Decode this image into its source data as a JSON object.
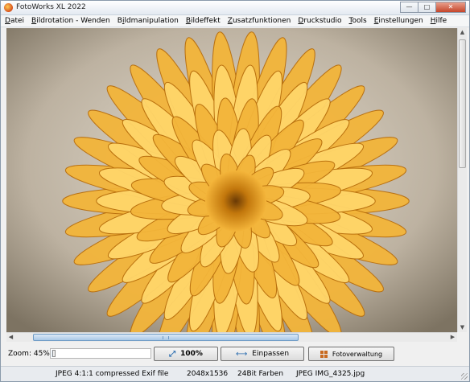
{
  "window": {
    "title": "FotoWorks XL 2022",
    "icon": "fotoworks-app-icon"
  },
  "menu": [
    {
      "pre": "",
      "u": "D",
      "post": "atei"
    },
    {
      "pre": "",
      "u": "B",
      "post": "ildrotation - Wenden"
    },
    {
      "pre": "B",
      "u": "i",
      "post": "ldmanipulation"
    },
    {
      "pre": "",
      "u": "B",
      "post": "ildeffekt"
    },
    {
      "pre": "",
      "u": "Z",
      "post": "usatzfunktionen"
    },
    {
      "pre": "",
      "u": "D",
      "post": "ruckstudio"
    },
    {
      "pre": "",
      "u": "T",
      "post": "ools"
    },
    {
      "pre": "",
      "u": "E",
      "post": "instellungen"
    },
    {
      "pre": "",
      "u": "H",
      "post": "ilfe"
    }
  ],
  "photo": {
    "subject": "yellow dahlia flower",
    "colors": {
      "petal": "#f3b53a",
      "shadow": "#b86e0c",
      "highlight": "#ffd66a"
    }
  },
  "toolbar": {
    "zoom_label": "Zoom: 45%",
    "zoom_level_percent": 45,
    "btn_100": "100%",
    "btn_fit": "Einpassen",
    "btn_manager": "Fotoverwaltung"
  },
  "status": {
    "format": "JPEG 4:1:1 compressed Exif file",
    "dimensions": "2048x1536",
    "depth": "24Bit Farben",
    "file": "JPEG IMG_4325.jpg"
  }
}
